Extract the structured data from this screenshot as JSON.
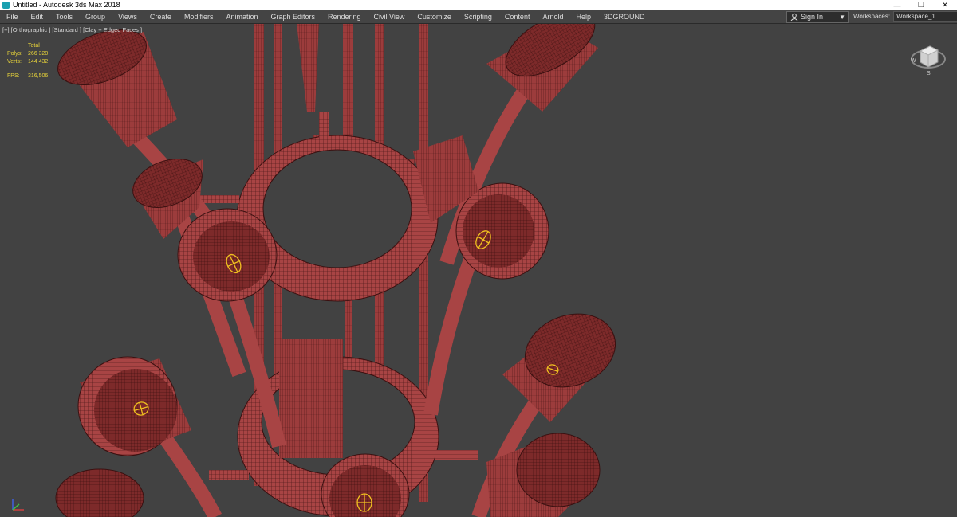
{
  "window": {
    "title": "Untitled - Autodesk 3ds Max 2018",
    "controls": {
      "minimize": "—",
      "restore": "❐",
      "close": "✕"
    }
  },
  "menubar": {
    "items": [
      "File",
      "Edit",
      "Tools",
      "Group",
      "Views",
      "Create",
      "Modifiers",
      "Animation",
      "Graph Editors",
      "Rendering",
      "Civil View",
      "Customize",
      "Scripting",
      "Content",
      "Arnold",
      "Help",
      "3DGROUND"
    ]
  },
  "signin": {
    "label": "Sign In"
  },
  "workspaces": {
    "label": "Workspaces:",
    "value": "Workspace_1"
  },
  "viewport": {
    "label": "[+] [Orthographic ] [Standard ] [Clay + Edged Faces ]",
    "stats": {
      "total_label": "Total",
      "polys_label": "Polys:",
      "polys": "266 320",
      "verts_label": "Verts:",
      "verts": "144 432",
      "fps_label": "FPS:",
      "fps": "316,506"
    }
  },
  "viewcube": {
    "west": "W",
    "south": "S"
  },
  "colors": {
    "model": "#a84444",
    "wire": "#3a1010",
    "light": "#f0c020",
    "stats": "#e6d23a"
  }
}
